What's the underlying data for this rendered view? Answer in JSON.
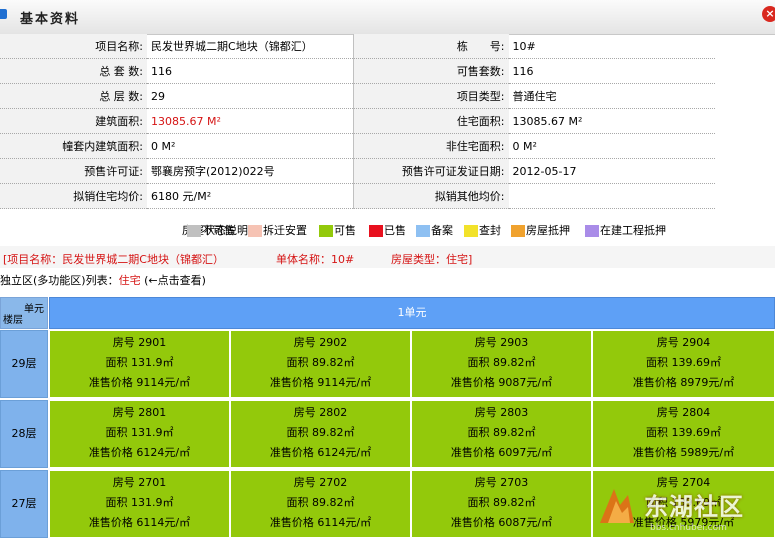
{
  "title": "基本资料",
  "close_glyph": "×",
  "info_rows": [
    {
      "l1": "项目名称:",
      "v1": "民发世界城二期C地块（锦都汇）",
      "l2": "栋　　号:",
      "v2": "10#"
    },
    {
      "l1": "总 套 数:",
      "v1": "116",
      "l2": "可售套数:",
      "v2": "116"
    },
    {
      "l1": "总 层 数:",
      "v1": "29",
      "l2": "项目类型:",
      "v2": "普通住宅"
    },
    {
      "l1": "建筑面积:",
      "v1": "13085.67 M²",
      "l2": "住宅面积:",
      "v2": "13085.67 M²"
    },
    {
      "l1": "幢套内建筑面积:",
      "v1": "0 M²",
      "l2": "非住宅面积:",
      "v2": "0 M²"
    },
    {
      "l1": "预售许可证:",
      "v1": "鄂襄房预字(2012)022号",
      "l2": "预售许可证发证日期:",
      "v2": "2012-05-17"
    },
    {
      "l1": "拟销住宅均价:",
      "v1": "6180 元/M²",
      "l2": "拟销其他均价:",
      "v2": ""
    }
  ],
  "legend": {
    "label": "房屋状态说明：",
    "items": [
      {
        "name": "不可售",
        "color": "#c0c0c0"
      },
      {
        "name": "拆迁安置",
        "color": "#f6c3b4"
      },
      {
        "name": "可售",
        "color": "#93c90b"
      },
      {
        "name": "已售",
        "color": "#e8101e"
      },
      {
        "name": "备案",
        "color": "#8ec0f2"
      },
      {
        "name": "查封",
        "color": "#f2e22a"
      },
      {
        "name": "房屋抵押",
        "color": "#f0a22e"
      },
      {
        "name": "在建工程抵押",
        "color": "#a98ce8"
      }
    ]
  },
  "summary": {
    "project": "[项目名称：民发世界城二期C地块（锦都汇）",
    "building": "单体名称：10#",
    "type": "房屋类型：住宅]"
  },
  "unit_line": {
    "prefix": "独立区(多功能区)列表：",
    "link": "住宅",
    "hint": "(←点击查看)"
  },
  "grid": {
    "corner_unit": "单元",
    "corner_floor": "楼层",
    "unit_header": "1单元",
    "floors": [
      {
        "label": "29层",
        "rooms": [
          {
            "no": "房号 2901",
            "area": "面积 131.9㎡",
            "price": "准售价格 9114元/㎡"
          },
          {
            "no": "房号 2902",
            "area": "面积 89.82㎡",
            "price": "准售价格 9114元/㎡"
          },
          {
            "no": "房号 2903",
            "area": "面积 89.82㎡",
            "price": "准售价格 9087元/㎡"
          },
          {
            "no": "房号 2904",
            "area": "面积 139.69㎡",
            "price": "准售价格 8979元/㎡"
          }
        ]
      },
      {
        "label": "28层",
        "rooms": [
          {
            "no": "房号 2801",
            "area": "面积 131.9㎡",
            "price": "准售价格 6124元/㎡"
          },
          {
            "no": "房号 2802",
            "area": "面积 89.82㎡",
            "price": "准售价格 6124元/㎡"
          },
          {
            "no": "房号 2803",
            "area": "面积 89.82㎡",
            "price": "准售价格 6097元/㎡"
          },
          {
            "no": "房号 2804",
            "area": "面积 139.69㎡",
            "price": "准售价格 5989元/㎡"
          }
        ]
      },
      {
        "label": "27层",
        "rooms": [
          {
            "no": "房号 2701",
            "area": "面积 131.9㎡",
            "price": "准售价格 6114元/㎡"
          },
          {
            "no": "房号 2702",
            "area": "面积 89.82㎡",
            "price": "准售价格 6114元/㎡"
          },
          {
            "no": "房号 2703",
            "area": "面积 89.82㎡",
            "price": "准售价格 6087元/㎡"
          },
          {
            "no": "房号 2704",
            "area": "面积 139.69㎡",
            "price": "准售价格 5979元/㎡"
          }
        ]
      }
    ]
  },
  "watermark": {
    "text": "东湖社区",
    "sub": "bbs.cnhubei.com"
  }
}
